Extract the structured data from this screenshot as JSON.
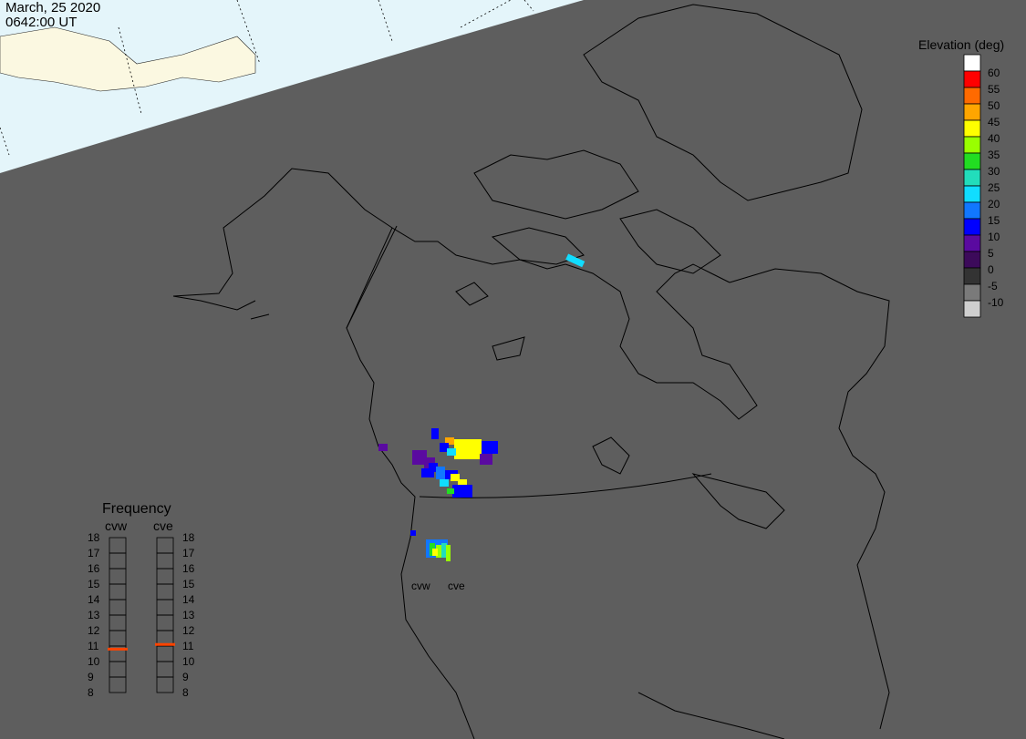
{
  "timestamp": {
    "date": "March, 25 2020",
    "time": "0642:00 UT"
  },
  "elevation_scale": {
    "title": "Elevation (deg)",
    "entries": [
      {
        "label": "60",
        "color": "#ffffff"
      },
      {
        "label": "55",
        "color": "#ff0000"
      },
      {
        "label": "50",
        "color": "#ff6a00"
      },
      {
        "label": "45",
        "color": "#ffa500"
      },
      {
        "label": "40",
        "color": "#ffff00"
      },
      {
        "label": "35",
        "color": "#99ff00"
      },
      {
        "label": "30",
        "color": "#22dd22"
      },
      {
        "label": "25",
        "color": "#22ddbb"
      },
      {
        "label": "20",
        "color": "#11ddff"
      },
      {
        "label": "15",
        "color": "#1177ff"
      },
      {
        "label": "10",
        "color": "#0000ff"
      },
      {
        "label": "5",
        "color": "#5a0aa0"
      },
      {
        "label": "0",
        "color": "#3c0a5a"
      },
      {
        "label": "-5",
        "color": "#333333"
      },
      {
        "label": "-10",
        "color": "#7a7a7a"
      },
      {
        "label": "",
        "color": "#cfcfcf"
      }
    ]
  },
  "frequency": {
    "title": "Frequency",
    "left_label": "cvw",
    "right_label": "cve",
    "ticks": [
      "18",
      "17",
      "16",
      "15",
      "14",
      "13",
      "12",
      "11",
      "10",
      "9",
      "8"
    ],
    "cvw_value": 10.8,
    "cve_value": 11.1,
    "marker_color": "#ff4400"
  },
  "radars": [
    {
      "label": "cvw"
    },
    {
      "label": "cve"
    }
  ],
  "colors": {
    "background": "#5e5e5e",
    "daylight": "#e4f5fa",
    "land_day": "#fbf8e1",
    "coast": "#000000"
  }
}
